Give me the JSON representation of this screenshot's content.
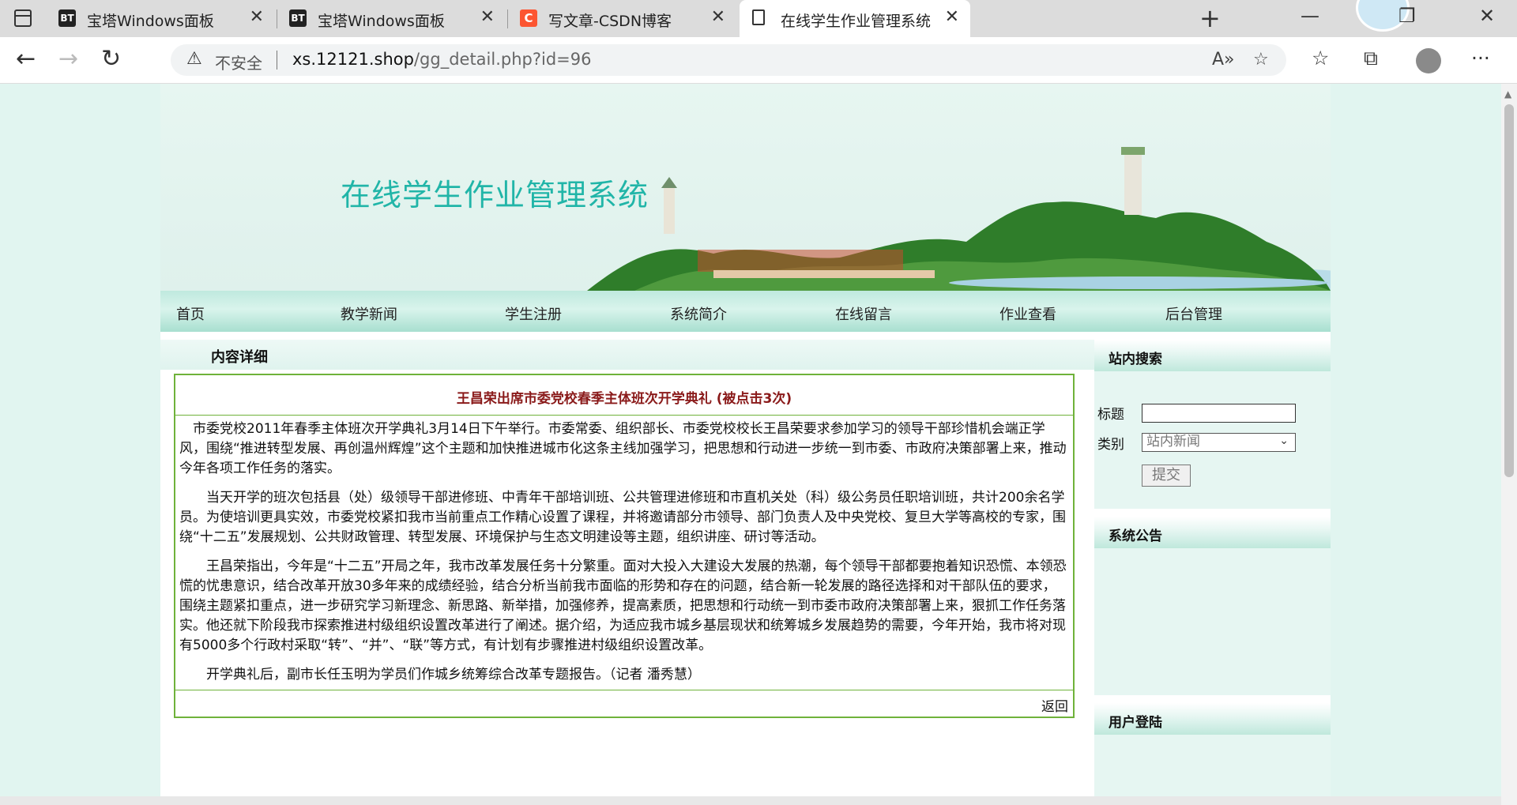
{
  "browser": {
    "tabs": [
      {
        "icon": "BT",
        "title": "宝塔Windows面板"
      },
      {
        "icon": "BT",
        "title": "宝塔Windows面板"
      },
      {
        "icon": "C",
        "title": "写文章-CSDN博客"
      },
      {
        "icon": "document-icon",
        "title": "在线学生作业管理系统"
      }
    ],
    "address": {
      "security_label": "不安全",
      "url_domain": "xs.12121.shop",
      "url_path": "/gg_detail.php?id=96"
    }
  },
  "site": {
    "title": "在线学生作业管理系统",
    "nav": [
      "首页",
      "教学新闻",
      "学生注册",
      "系统简介",
      "在线留言",
      "作业查看",
      "后台管理"
    ]
  },
  "content": {
    "header": "内容详细",
    "article_title": "王昌荣出席市委党校春季主体班次开学典礼 (被点击3次)",
    "paragraphs": [
      "市委党校2011年春季主体班次开学典礼3月14日下午举行。市委常委、组织部长、市委党校校长王昌荣要求参加学习的领导干部珍惜机会端正学风，围绕“推进转型发展、再创温州辉煌”这个主题和加快推进城市化这条主线加强学习，把思想和行动进一步统一到市委、市政府决策部署上来，推动今年各项工作任务的落实。",
      "当天开学的班次包括县（处）级领导干部进修班、中青年干部培训班、公共管理进修班和市直机关处（科）级公务员任职培训班，共计200余名学员。为使培训更具实效，市委党校紧扣我市当前重点工作精心设置了课程，并将邀请部分市领导、部门负责人及中央党校、复旦大学等高校的专家，围绕“十二五”发展规划、公共财政管理、转型发展、环境保护与生态文明建设等主题，组织讲座、研讨等活动。",
      "王昌荣指出，今年是“十二五”开局之年，我市改革发展任务十分繁重。面对大投入大建设大发展的热潮，每个领导干部都要抱着知识恐慌、本领恐慌的忧患意识，结合改革开放30多年来的成绩经验，结合分析当前我市面临的形势和存在的问题，结合新一轮发展的路径选择和对干部队伍的要求，围绕主题紧扣重点，进一步研究学习新理念、新思路、新举措，加强修养，提高素质，把思想和行动统一到市委市政府决策部署上来，狠抓工作任务落实。他还就下阶段我市探索推进村级组织设置改革进行了阐述。据介绍，为适应我市城乡基层现状和统筹城乡发展趋势的需要，今年开始，我市将对现有5000多个行政村采取“转”、“并”、“联”等方式，有计划有步骤推进村级组织设置改革。",
      "开学典礼后，副市长任玉明为学员们作城乡统筹综合改革专题报告。（记者 潘秀慧）"
    ],
    "back_label": "返回"
  },
  "sidebar": {
    "search": {
      "header": "站内搜索",
      "title_label": "标题",
      "title_value": "",
      "category_label": "类别",
      "category_value": "站内新闻",
      "submit_label": "提交"
    },
    "notice_header": "系统公告",
    "login_header": "用户登陆"
  }
}
